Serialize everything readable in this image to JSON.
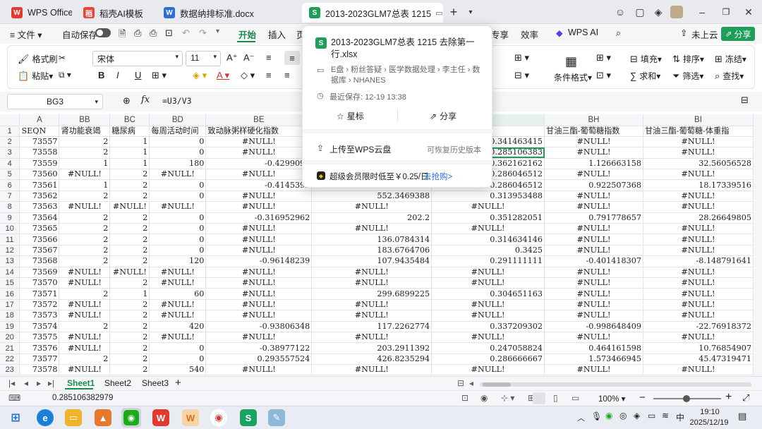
{
  "tabs": [
    {
      "label": "WPS Office"
    },
    {
      "label": "稻壳AI模板"
    },
    {
      "label": "数据纳排标准.docx"
    },
    {
      "label": "2013-2023GLM7总表 1215"
    }
  ],
  "menu": {
    "file": "文件",
    "autosave": "自动保存",
    "items": [
      "开始",
      "插入",
      "页"
    ],
    "right_items": [
      "专享",
      "效率"
    ],
    "wps_ai": "WPS AI",
    "cloud": "未上云",
    "share": "分享"
  },
  "ribbon": {
    "format_painter": "格式刷",
    "paste": "粘贴",
    "font": "宋体",
    "font_size": "11",
    "bold": "B",
    "italic": "I",
    "underline": "U",
    "cond_format": "条件格式",
    "fill": "填充",
    "sort": "排序",
    "freeze": "冻结",
    "sum": "求和",
    "filter": "筛选",
    "find": "查找"
  },
  "formula": {
    "cell_ref": "BG3",
    "fx": "fx",
    "content": "=U3/V3"
  },
  "columns": [
    "",
    "A",
    "BB",
    "BC",
    "BD",
    "BE",
    "",
    "",
    "BH",
    "BI"
  ],
  "header_row": [
    "SEQN",
    "肾功能衰竭",
    "糖尿病",
    "每周活动时间",
    "致动脉粥样硬化指数",
    "",
    "/白蛋白比值",
    "甘油三酯-葡萄糖指数",
    "甘油三酯-葡萄糖-体重指"
  ],
  "rows": [
    [
      "2",
      "73557",
      "2",
      "1",
      "0",
      "#NULL!",
      "",
      "0.341463415",
      "#NULL!",
      "#NULL!"
    ],
    [
      "3",
      "73558",
      "2",
      "1",
      "0",
      "#NULL!",
      "",
      "0.285106383",
      "#NULL!",
      "#NULL!"
    ],
    [
      "4",
      "73559",
      "1",
      "1",
      "180",
      "-0.4299092",
      "",
      "0.362162162",
      "1.126663158",
      "32.56056528"
    ],
    [
      "5",
      "73560",
      "#NULL!",
      "2",
      "#NULL!",
      "#NULL!",
      "",
      "0.286046512",
      "#NULL!",
      "#NULL!"
    ],
    [
      "6",
      "73561",
      "1",
      "2",
      "0",
      "-0.4145392",
      "",
      "0.286046512",
      "0.922507368",
      "18.17339516"
    ],
    [
      "7",
      "73562",
      "2",
      "2",
      "0",
      "#NULL!",
      "552.3469388",
      "0.313953488",
      "#NULL!",
      "#NULL!"
    ],
    [
      "8",
      "73563",
      "#NULL!",
      "#NULL!",
      "#NULL!",
      "#NULL!",
      "#NULL!",
      "#NULL!",
      "#NULL!",
      "#NULL!"
    ],
    [
      "9",
      "73564",
      "2",
      "2",
      "0",
      "-0.316952962",
      "202.2",
      "0.351282051",
      "0.791778657",
      "28.26649805"
    ],
    [
      "10",
      "73565",
      "2",
      "2",
      "0",
      "#NULL!",
      "#NULL!",
      "#NULL!",
      "#NULL!",
      "#NULL!"
    ],
    [
      "11",
      "73566",
      "2",
      "2",
      "0",
      "#NULL!",
      "136.0784314",
      "0.314634146",
      "#NULL!",
      "#NULL!"
    ],
    [
      "12",
      "73567",
      "2",
      "2",
      "0",
      "#NULL!",
      "183.6764706",
      "0.3425",
      "#NULL!",
      "#NULL!"
    ],
    [
      "13",
      "73568",
      "2",
      "2",
      "120",
      "-0.96148239",
      "107.9435484",
      "0.291111111",
      "-0.401418307",
      "-8.148791641"
    ],
    [
      "14",
      "73569",
      "#NULL!",
      "#NULL!",
      "#NULL!",
      "#NULL!",
      "#NULL!",
      "#NULL!",
      "#NULL!",
      "#NULL!"
    ],
    [
      "15",
      "73570",
      "#NULL!",
      "2",
      "#NULL!",
      "#NULL!",
      "#NULL!",
      "#NULL!",
      "#NULL!",
      "#NULL!"
    ],
    [
      "16",
      "73571",
      "2",
      "1",
      "60",
      "#NULL!",
      "299.6899225",
      "0.304651163",
      "#NULL!",
      "#NULL!"
    ],
    [
      "17",
      "73572",
      "#NULL!",
      "2",
      "#NULL!",
      "#NULL!",
      "#NULL!",
      "#NULL!",
      "#NULL!",
      "#NULL!"
    ],
    [
      "18",
      "73573",
      "#NULL!",
      "2",
      "#NULL!",
      "#NULL!",
      "#NULL!",
      "#NULL!",
      "#NULL!",
      "#NULL!"
    ],
    [
      "19",
      "73574",
      "2",
      "2",
      "420",
      "-0.93806348",
      "117.2262774",
      "0.337209302",
      "-0.998648409",
      "-22.76918372"
    ],
    [
      "20",
      "73575",
      "#NULL!",
      "2",
      "#NULL!",
      "#NULL!",
      "#NULL!",
      "#NULL!",
      "#NULL!",
      "#NULL!"
    ],
    [
      "21",
      "73576",
      "#NULL!",
      "2",
      "0",
      "-0.38977122",
      "203.2911392",
      "0.247058824",
      "0.464161598",
      "10.76854907"
    ],
    [
      "22",
      "73577",
      "2",
      "2",
      "0",
      "0.293557524",
      "426.8235294",
      "0.286666667",
      "1.573466945",
      "45.47319471"
    ],
    [
      "23",
      "73578",
      "#NULL!",
      "2",
      "540",
      "#NULL!",
      "#NULL!",
      "#NULL!",
      "#NULL!",
      "#NULL!"
    ]
  ],
  "sheets": [
    "Sheet1",
    "Sheet2",
    "Sheet3"
  ],
  "status": {
    "value": "0.285106382979",
    "zoom": "100%"
  },
  "popup": {
    "filename": "2013-2023GLM7总表 1215 去除第一行.xlsx",
    "path": "E盘 › 粉丝答疑 › 医学数据处理 › 李主任 › 数据库 › NHANES",
    "saved": "最近保存: 12-19 13:38",
    "star": "星标",
    "share": "分享",
    "upload": "上传至WPS云盘",
    "history": "可恢复历史版本",
    "promo": "超级会员限时低至￥0.25/日",
    "promo_link": "去抢购>"
  },
  "taskbar": {
    "time": "19:10",
    "date": "2025/12/19",
    "lang": "中"
  }
}
